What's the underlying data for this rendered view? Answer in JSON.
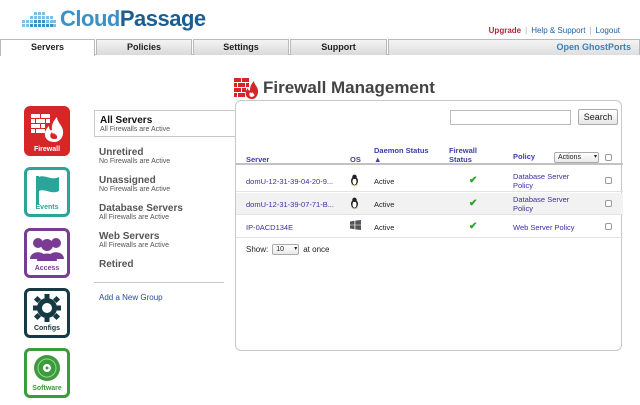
{
  "brand": {
    "part1": "Cloud",
    "part2": "Passage"
  },
  "toplinks": {
    "upgrade": "Upgrade",
    "help": "Help & Support",
    "logout": "Logout",
    "sep": "|"
  },
  "tabs": [
    {
      "label": "Servers"
    },
    {
      "label": "Policies"
    },
    {
      "label": "Settings"
    },
    {
      "label": "Support"
    },
    {
      "label": "Open GhostPorts"
    }
  ],
  "sidebar": {
    "firewall": "Firewall",
    "events": "Events",
    "access": "Access",
    "configs": "Configs",
    "software": "Software"
  },
  "groups": [
    {
      "name": "All Servers",
      "sub": "All Firewalls are Active"
    },
    {
      "name": "Unretired",
      "sub": "No Firewalls are Active"
    },
    {
      "name": "Unassigned",
      "sub": "No Firewalls are Active"
    },
    {
      "name": "Database Servers",
      "sub": "All Firewalls are Active"
    },
    {
      "name": "Web Servers",
      "sub": "All Firewalls are Active"
    },
    {
      "name": "Retired",
      "sub": ""
    }
  ],
  "add_group": "Add a New Group",
  "heading": "Firewall Management",
  "search": {
    "placeholder": "",
    "button": "Search"
  },
  "table": {
    "headers": {
      "server": "Server",
      "os": "OS",
      "daemon": "Daemon Status",
      "daemon_sort": "▲",
      "firewall": "Firewall",
      "firewall2": "Status",
      "policy": "Policy"
    },
    "actions": "Actions",
    "rows": [
      {
        "server": "domU-12-31-39-04-20-9...",
        "os": "linux",
        "status": "Active",
        "firewall": "✔",
        "policy": "Database Server Policy"
      },
      {
        "server": "domU-12-31-39-07-71-B...",
        "os": "linux",
        "status": "Active",
        "firewall": "✔",
        "policy": "Database Server Policy"
      },
      {
        "server": "IP-0ACD134E",
        "os": "windows",
        "status": "Active",
        "firewall": "✔",
        "policy": "Web Server Policy"
      }
    ]
  },
  "pager": {
    "show": "Show:",
    "count": "10",
    "suffix": "at once"
  },
  "colors": {
    "firewall": "#d72628",
    "events": "#2aa59a",
    "access": "#7a3c93",
    "configs": "#163a43",
    "software": "#3c9b3a",
    "link": "#3b2fa0"
  }
}
